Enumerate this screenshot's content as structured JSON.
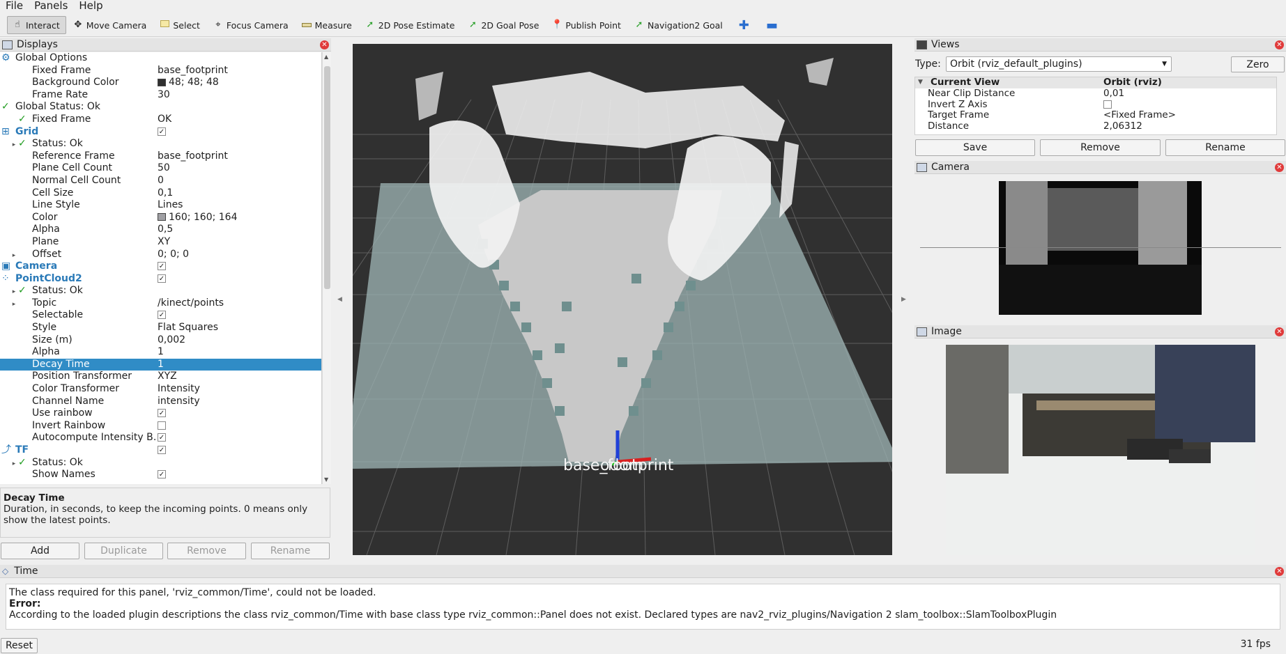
{
  "menu": [
    "File",
    "Panels",
    "Help"
  ],
  "toolbar": {
    "tools": [
      {
        "label": "Interact",
        "icon": "cursor-icon",
        "active": true
      },
      {
        "label": "Move Camera",
        "icon": "move-camera-icon"
      },
      {
        "label": "Select",
        "icon": "select-icon"
      },
      {
        "label": "Focus Camera",
        "icon": "focus-camera-icon"
      },
      {
        "label": "Measure",
        "icon": "ruler-icon"
      },
      {
        "label": "2D Pose Estimate",
        "icon": "pose-arrow-icon"
      },
      {
        "label": "2D Goal Pose",
        "icon": "goal-arrow-icon"
      },
      {
        "label": "Publish Point",
        "icon": "map-pin-icon"
      },
      {
        "label": "Navigation2 Goal",
        "icon": "nav-goal-icon"
      }
    ]
  },
  "displays": {
    "title": "Displays",
    "rows": [
      {
        "k": "Global Options",
        "v": "",
        "indent": 0,
        "icon": "gear"
      },
      {
        "k": "Fixed Frame",
        "v": "base_footprint",
        "indent": 1
      },
      {
        "k": "Background Color",
        "v": "48; 48; 48",
        "indent": 1,
        "swatch": "#303030"
      },
      {
        "k": "Frame Rate",
        "v": "30",
        "indent": 1
      },
      {
        "k": "Global Status: Ok",
        "v": "",
        "indent": 0,
        "ok": true
      },
      {
        "k": "Fixed Frame",
        "v": "OK",
        "indent": 1,
        "ok": true
      },
      {
        "k": "Grid",
        "v": "",
        "indent": 0,
        "blue": true,
        "check": true,
        "icon": "grid"
      },
      {
        "k": "Status: Ok",
        "v": "",
        "indent": 1,
        "ok": true,
        "exp": true
      },
      {
        "k": "Reference Frame",
        "v": "base_footprint",
        "indent": 1
      },
      {
        "k": "Plane Cell Count",
        "v": "50",
        "indent": 1
      },
      {
        "k": "Normal Cell Count",
        "v": "0",
        "indent": 1
      },
      {
        "k": "Cell Size",
        "v": "0,1",
        "indent": 1
      },
      {
        "k": "Line Style",
        "v": "Lines",
        "indent": 1
      },
      {
        "k": "Color",
        "v": "160; 160; 164",
        "indent": 1,
        "swatch": "#a0a0a4"
      },
      {
        "k": "Alpha",
        "v": "0,5",
        "indent": 1
      },
      {
        "k": "Plane",
        "v": "XY",
        "indent": 1
      },
      {
        "k": "Offset",
        "v": "0; 0; 0",
        "indent": 1,
        "exp": true
      },
      {
        "k": "Camera",
        "v": "",
        "indent": 0,
        "blue": true,
        "check": true,
        "icon": "camera"
      },
      {
        "k": "PointCloud2",
        "v": "",
        "indent": 0,
        "blue": true,
        "check": true,
        "icon": "points"
      },
      {
        "k": "Status: Ok",
        "v": "",
        "indent": 1,
        "ok": true,
        "exp": true
      },
      {
        "k": "Topic",
        "v": "/kinect/points",
        "indent": 1,
        "exp": true
      },
      {
        "k": "Selectable",
        "v": "",
        "indent": 1,
        "check": true
      },
      {
        "k": "Style",
        "v": "Flat Squares",
        "indent": 1
      },
      {
        "k": "Size (m)",
        "v": "0,002",
        "indent": 1
      },
      {
        "k": "Alpha",
        "v": "1",
        "indent": 1
      },
      {
        "k": "Decay Time",
        "v": "1",
        "indent": 1,
        "selected": true
      },
      {
        "k": "Position Transformer",
        "v": "XYZ",
        "indent": 1
      },
      {
        "k": "Color Transformer",
        "v": "Intensity",
        "indent": 1
      },
      {
        "k": "Channel Name",
        "v": "intensity",
        "indent": 1
      },
      {
        "k": "Use rainbow",
        "v": "",
        "indent": 1,
        "check": true
      },
      {
        "k": "Invert Rainbow",
        "v": "",
        "indent": 1,
        "uncheck": true
      },
      {
        "k": "Autocompute Intensity B…",
        "v": "",
        "indent": 1,
        "check": true
      },
      {
        "k": "TF",
        "v": "",
        "indent": 0,
        "blue": true,
        "check": true,
        "icon": "tf"
      },
      {
        "k": "Status: Ok",
        "v": "",
        "indent": 1,
        "ok": true,
        "exp": true
      },
      {
        "k": "Show Names",
        "v": "",
        "indent": 1,
        "check": true
      }
    ],
    "desc_title": "Decay Time",
    "desc_text": "Duration, in seconds, to keep the incoming points. 0 means only show the latest points.",
    "buttons": {
      "add": "Add",
      "duplicate": "Duplicate",
      "remove": "Remove",
      "rename": "Rename"
    }
  },
  "view3d": {
    "frame_label": "base_footprint",
    "frame_label_overlap": "odom"
  },
  "views": {
    "title": "Views",
    "type_label": "Type:",
    "type_value": "Orbit (rviz_default_plugins)",
    "zero": "Zero",
    "header_k": "Current View",
    "header_v": "Orbit (rviz)",
    "rows": [
      {
        "k": "Near Clip Distance",
        "v": "0,01"
      },
      {
        "k": "Invert Z Axis",
        "v": ""
      },
      {
        "k": "Target Frame",
        "v": "<Fixed Frame>"
      },
      {
        "k": "Distance",
        "v": "2,06312"
      }
    ],
    "save": "Save",
    "remove": "Remove",
    "rename": "Rename"
  },
  "camera": {
    "title": "Camera"
  },
  "image": {
    "title": "Image"
  },
  "time": {
    "title": "Time",
    "line1": "The class required for this panel, 'rviz_common/Time', could not be loaded.",
    "error_label": "Error:",
    "line2": "According to the loaded plugin descriptions the class rviz_common/Time with base class type rviz_common::Panel does not exist. Declared types are nav2_rviz_plugins/Navigation 2 slam_toolbox::SlamToolboxPlugin"
  },
  "reset": "Reset",
  "fps": "31 fps",
  "colors": {
    "selection": "#308cc6",
    "background": "#303030",
    "grid_plane": "#9fb6b6",
    "floor": "#c8c8c8"
  }
}
